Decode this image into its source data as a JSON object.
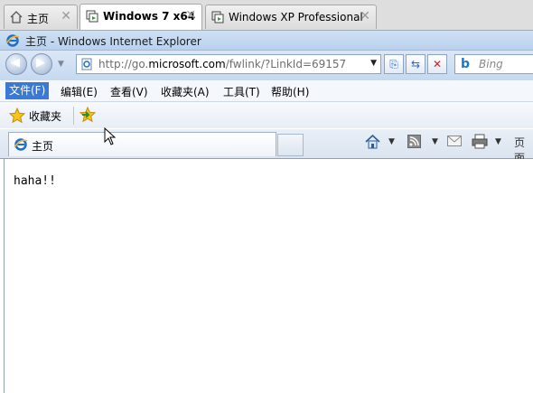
{
  "vm_tabs": [
    {
      "label": "主页",
      "active": false
    },
    {
      "label": "Windows 7 x64",
      "active": true
    },
    {
      "label": "Windows XP Professional",
      "active": false
    }
  ],
  "window": {
    "title": "主页 - Windows Internet Explorer"
  },
  "address": {
    "url_prefix": "http://go.",
    "url_domain": "microsoft.com",
    "url_suffix": "/fwlink/?LinkId=69157"
  },
  "search": {
    "placeholder": "Bing"
  },
  "menu": {
    "items": [
      "文件(F)",
      "编辑(E)",
      "查看(V)",
      "收藏夹(A)",
      "工具(T)",
      "帮助(H)"
    ],
    "selected_index": 0
  },
  "favorites": {
    "label": "收藏夹"
  },
  "tab": {
    "label": "主页"
  },
  "command_bar": {
    "page_label": "页面"
  },
  "content": {
    "text": "haha!!"
  },
  "colors": {
    "menu_highlight": "#3a79d6",
    "frame": "#c6d9f1"
  }
}
